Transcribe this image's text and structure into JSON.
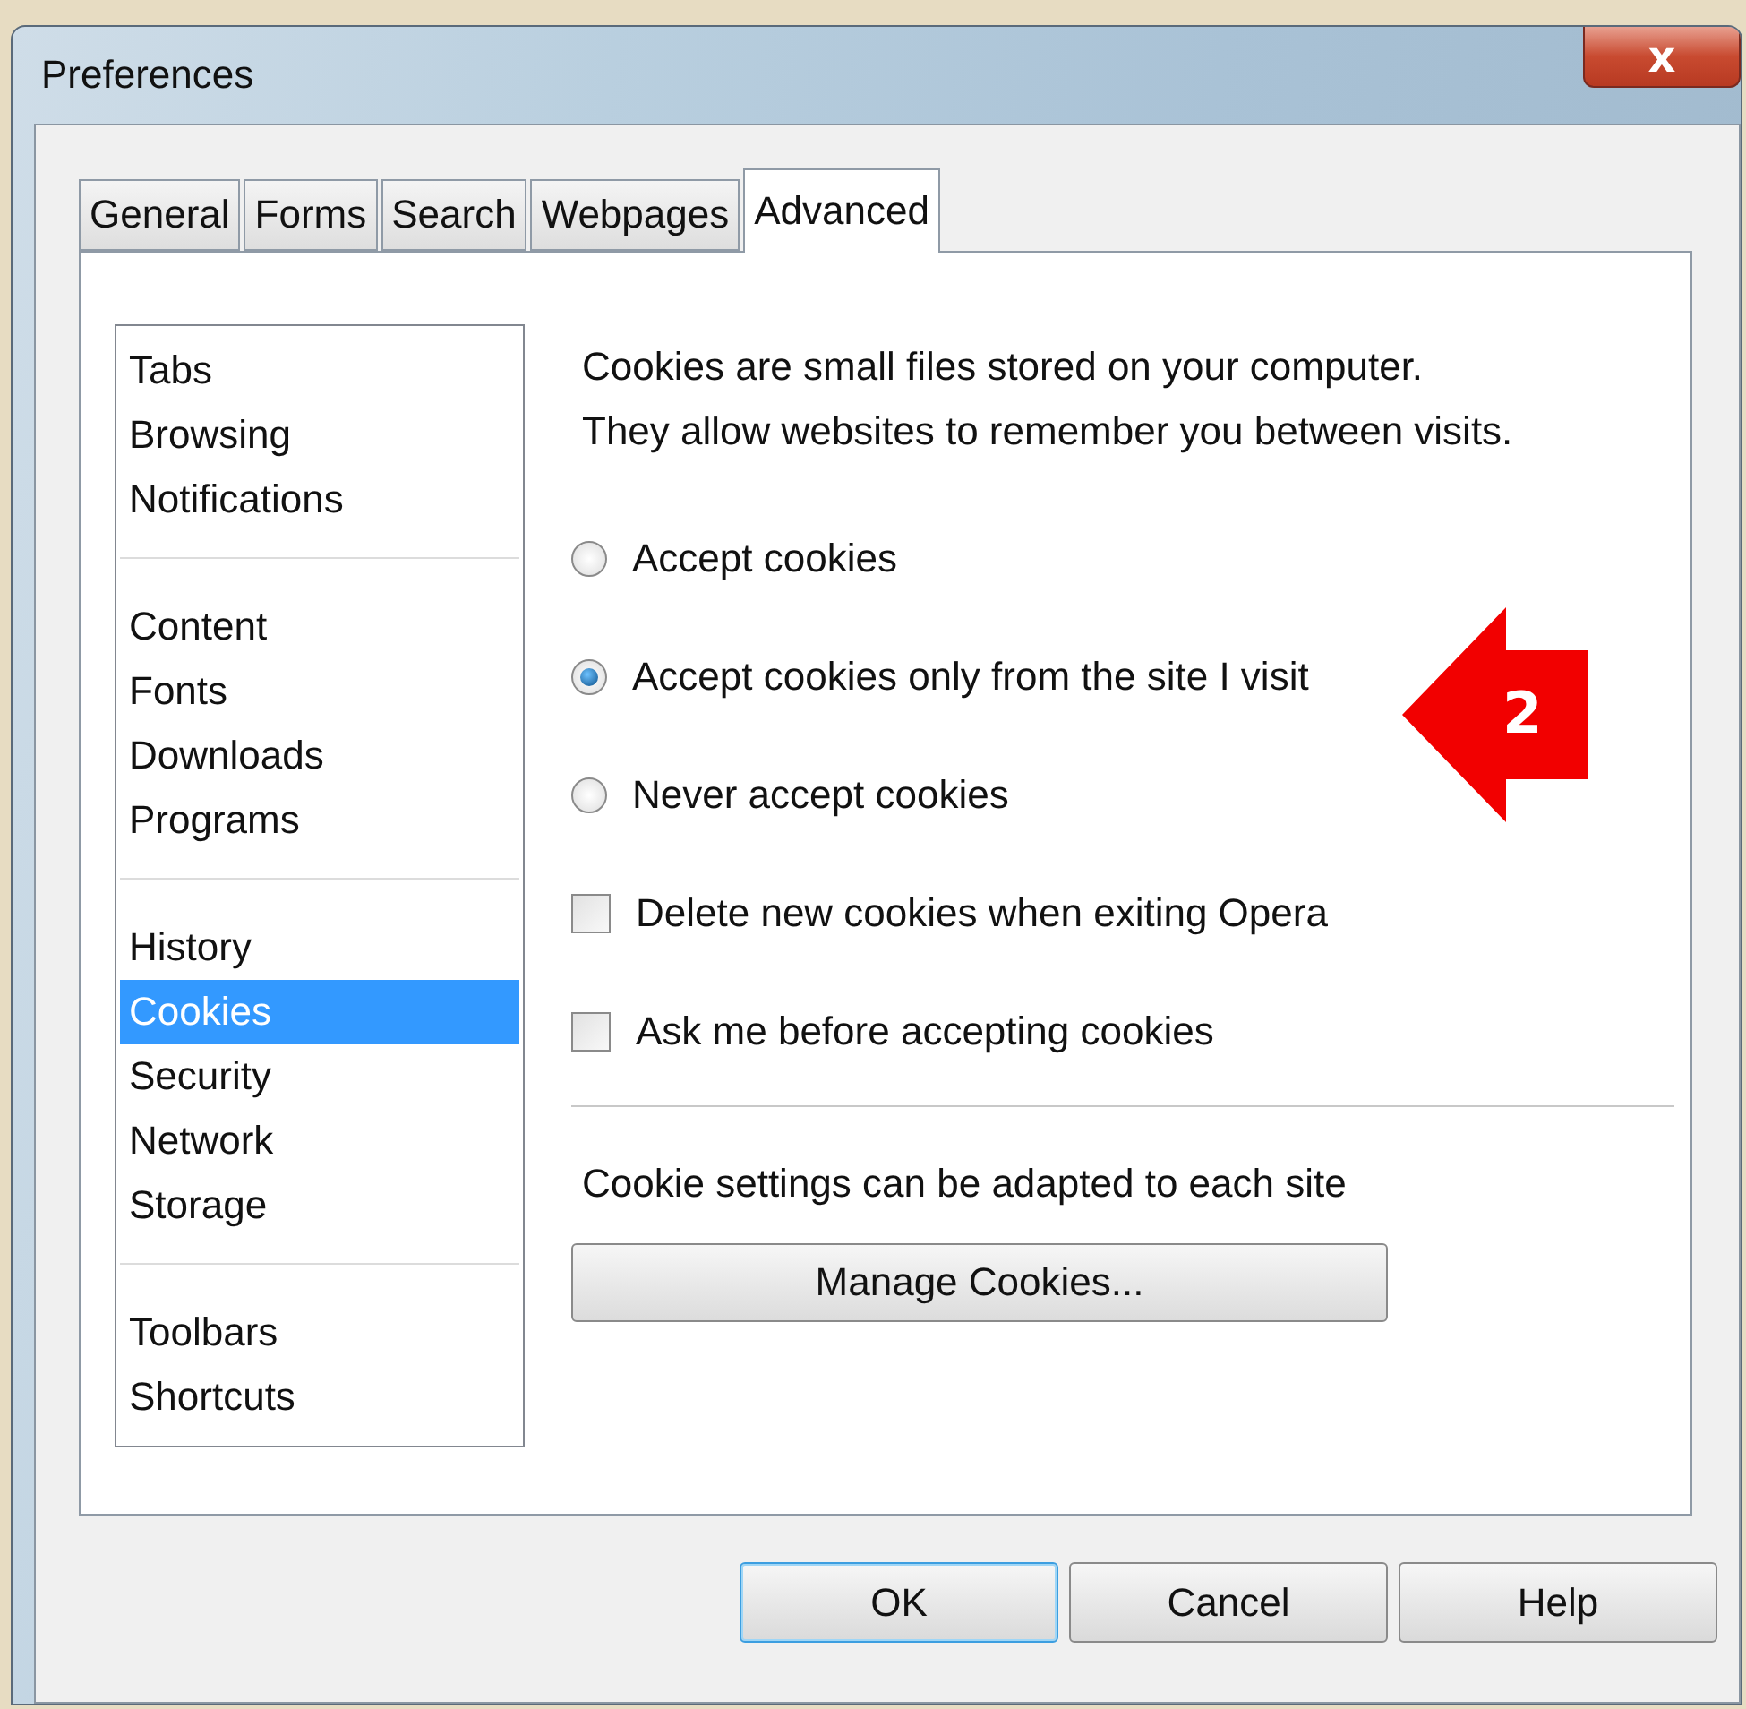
{
  "window": {
    "title": "Preferences",
    "close_label": "x"
  },
  "tabs": [
    {
      "label": "General",
      "selected": false
    },
    {
      "label": "Forms",
      "selected": false
    },
    {
      "label": "Search",
      "selected": false
    },
    {
      "label": "Webpages",
      "selected": false
    },
    {
      "label": "Advanced",
      "selected": true
    }
  ],
  "sidebar": {
    "groups": [
      {
        "items": [
          {
            "label": "Tabs",
            "selected": false
          },
          {
            "label": "Browsing",
            "selected": false
          },
          {
            "label": "Notifications",
            "selected": false
          }
        ]
      },
      {
        "items": [
          {
            "label": "Content",
            "selected": false
          },
          {
            "label": "Fonts",
            "selected": false
          },
          {
            "label": "Downloads",
            "selected": false
          },
          {
            "label": "Programs",
            "selected": false
          }
        ]
      },
      {
        "items": [
          {
            "label": "History",
            "selected": false
          },
          {
            "label": "Cookies",
            "selected": true
          },
          {
            "label": "Security",
            "selected": false
          },
          {
            "label": "Network",
            "selected": false
          },
          {
            "label": "Storage",
            "selected": false
          }
        ]
      },
      {
        "items": [
          {
            "label": "Toolbars",
            "selected": false
          },
          {
            "label": "Shortcuts",
            "selected": false
          }
        ]
      }
    ]
  },
  "description": [
    "Cookies are small files stored on your computer.",
    "They allow websites to remember  you between visits."
  ],
  "options": [
    {
      "kind": "radio",
      "label": "Accept cookies",
      "selected": false
    },
    {
      "kind": "radio",
      "label": "Accept cookies only from the site I visit",
      "selected": true
    },
    {
      "kind": "radio",
      "label": "Never accept cookies",
      "selected": false
    },
    {
      "kind": "checkbox",
      "label": "Delete new cookies when exiting Opera",
      "checked": false
    },
    {
      "kind": "checkbox",
      "label": "Ask me before accepting cookies",
      "checked": false
    }
  ],
  "site_note": "Cookie settings can be adapted to each site",
  "manage_button": "Manage Cookies...",
  "callout": {
    "label": "2"
  },
  "buttons": [
    {
      "label": "OK",
      "default": true
    },
    {
      "label": "Cancel",
      "default": false
    },
    {
      "label": "Help",
      "default": false
    }
  ]
}
